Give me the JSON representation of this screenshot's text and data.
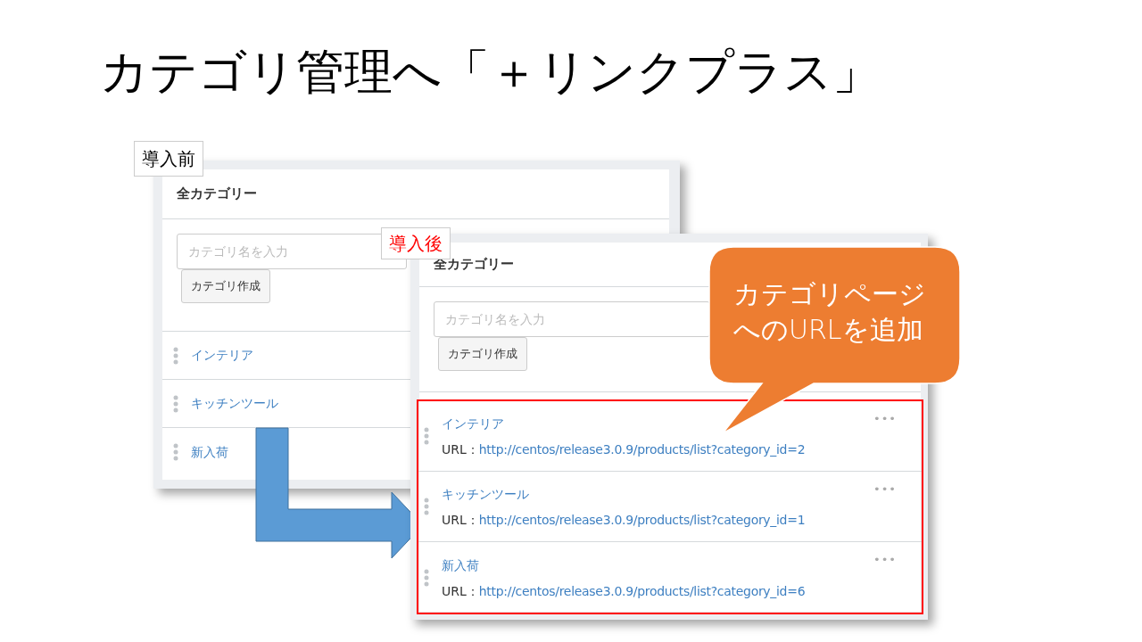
{
  "slide_title": "カテゴリ管理へ「＋リンクプラス」",
  "before": {
    "label": "導入前",
    "title": "全カテゴリー",
    "input": {
      "placeholder": "カテゴリ名を入力"
    },
    "button": "カテゴリ作成",
    "items": [
      {
        "name": "インテリア"
      },
      {
        "name": "キッチンツール"
      },
      {
        "name": "新入荷"
      }
    ]
  },
  "after": {
    "label": "導入後",
    "title": "全カテゴリー",
    "input": {
      "placeholder": "カテゴリ名を入力"
    },
    "button": "カテゴリ作成",
    "items": [
      {
        "name": "インテリア",
        "url_label": "URL：",
        "url": "http://centos/release3.0.9/products/list?category_id=2",
        "menu": "•••"
      },
      {
        "name": "キッチンツール",
        "url_label": "URL：",
        "url": "http://centos/release3.0.9/products/list?category_id=1",
        "menu": "•••"
      },
      {
        "name": "新入荷",
        "url_label": "URL：",
        "url": "http://centos/release3.0.9/products/list?category_id=6",
        "menu": "•••"
      }
    ]
  },
  "callout": "カテゴリページへのURLを追加"
}
